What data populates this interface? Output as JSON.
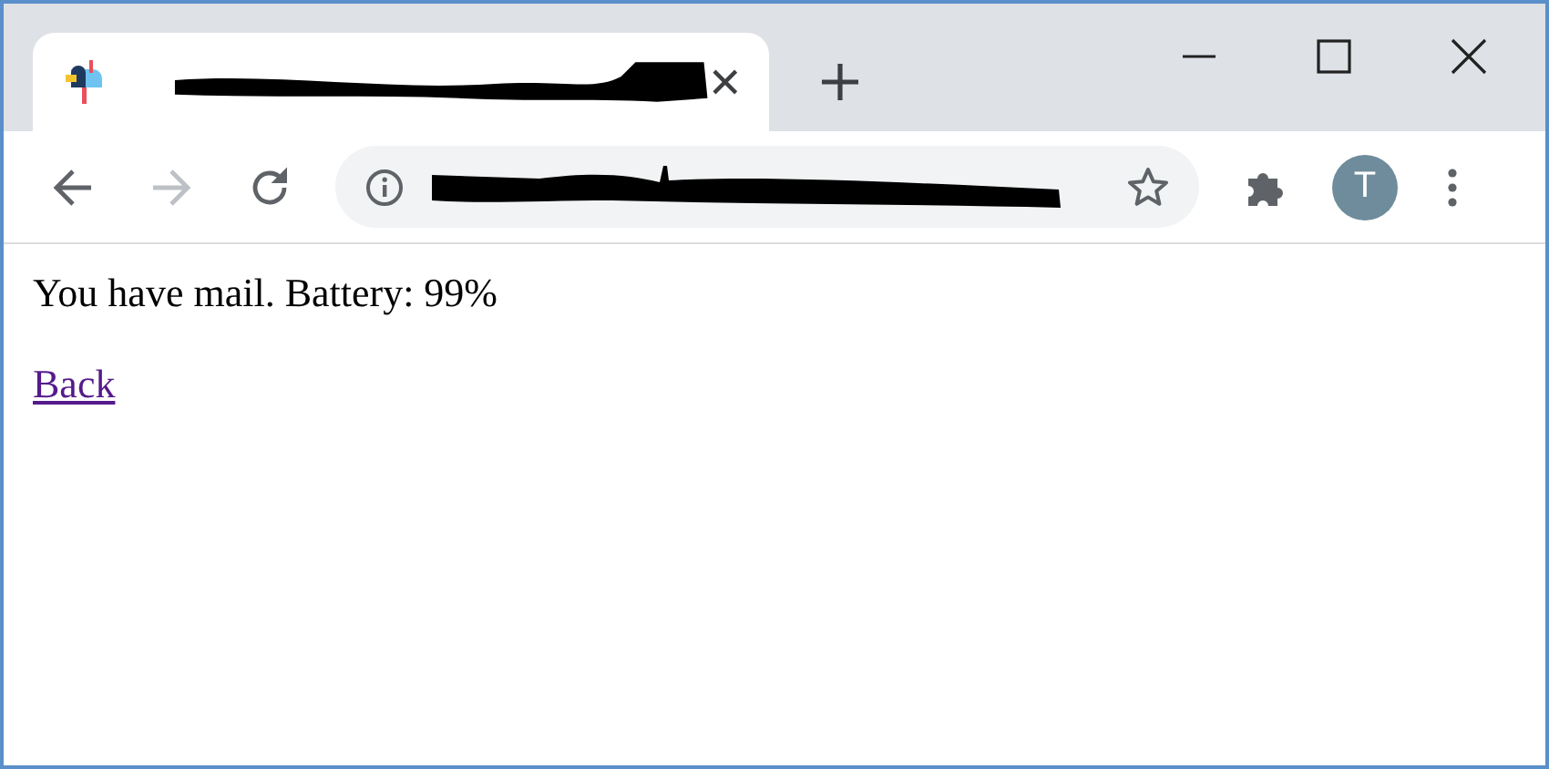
{
  "toolbar": {
    "back_disabled": false,
    "forward_disabled": true,
    "profile_initial": "T"
  },
  "page": {
    "message": "You have mail. Battery: 99%",
    "link": "Back"
  }
}
